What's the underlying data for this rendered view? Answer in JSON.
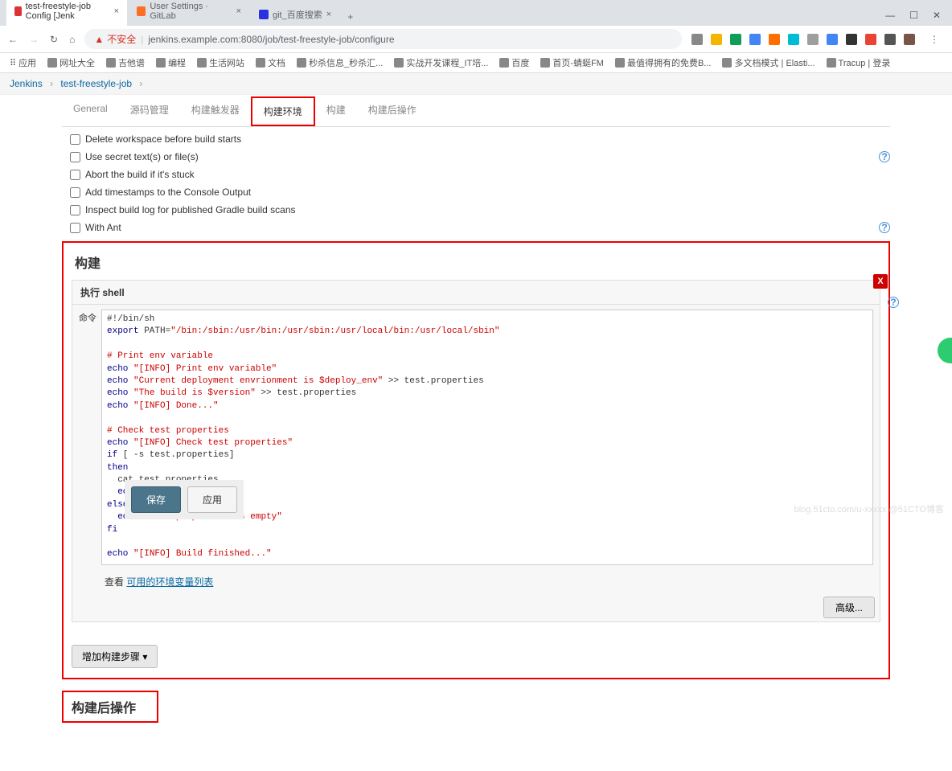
{
  "browser": {
    "tabs": [
      {
        "title": "test-freestyle-job Config [Jenk",
        "favicon": "#d33"
      },
      {
        "title": "User Settings · GitLab",
        "favicon": "#fc6d26"
      },
      {
        "title": "git_百度搜索",
        "favicon": "#2932e1"
      }
    ],
    "window_controls": {
      "min": "—",
      "max": "☐",
      "close": "✕"
    },
    "nav": {
      "back": "←",
      "forward": "→",
      "reload": "↻",
      "home": "⌂"
    },
    "insecure_label": "不安全",
    "url": "jenkins.example.com:8080/job/test-freestyle-job/configure",
    "ext_colors": [
      "#888",
      "#f4b400",
      "#0f9d58",
      "#4285f4",
      "#ff6f00",
      "#00bcd4",
      "#9e9e9e",
      "#4285f4",
      "#333",
      "#ea4335",
      "#555",
      "#795548"
    ],
    "menu": "⋮"
  },
  "bookmarks": {
    "apps": "应用",
    "items": [
      "网址大全",
      "吉他谱",
      "编程",
      "生活网站",
      "文档",
      "秒杀信息_秒杀汇...",
      "实战开发课程_IT培...",
      "百度",
      "首页-蜻蜓FM",
      "最值得拥有的免费B...",
      "多文档模式 | Elasti...",
      "Tracup | 登录"
    ]
  },
  "breadcrumb": {
    "root": "Jenkins",
    "job": "test-freestyle-job"
  },
  "config_tabs": [
    "General",
    "源码管理",
    "构建触发器",
    "构建环境",
    "构建",
    "构建后操作"
  ],
  "active_tab_index": 3,
  "env_checkboxes": [
    {
      "label": "Delete workspace before build starts",
      "help": false
    },
    {
      "label": "Use secret text(s) or file(s)",
      "help": true
    },
    {
      "label": "Abort the build if it's stuck",
      "help": false
    },
    {
      "label": "Add timestamps to the Console Output",
      "help": false
    },
    {
      "label": "Inspect build log for published Gradle build scans",
      "help": false
    },
    {
      "label": "With Ant",
      "help": true
    }
  ],
  "build": {
    "section_title": "构建",
    "step_title": "执行 shell",
    "command_label": "命令",
    "script_lines": [
      {
        "t": "#!/bin/sh",
        "cls": ""
      },
      {
        "t": "export PATH=\"/bin:/sbin:/usr/bin:/usr/sbin:/usr/local/bin:/usr/local/sbin\"",
        "cls": "mix1"
      },
      {
        "t": "",
        "cls": ""
      },
      {
        "t": "# Print env variable",
        "cls": "str"
      },
      {
        "t": "echo \"[INFO] Print env variable\"",
        "cls": "mix2"
      },
      {
        "t": "echo \"Current deployment envrionment is $deploy_env\" >> test.properties",
        "cls": "mix3"
      },
      {
        "t": "echo \"The build is $version\" >> test.properties",
        "cls": "mix3"
      },
      {
        "t": "echo \"[INFO] Done...\"",
        "cls": "mix2"
      },
      {
        "t": "",
        "cls": ""
      },
      {
        "t": "# Check test properties",
        "cls": "str"
      },
      {
        "t": "echo \"[INFO] Check test properties\"",
        "cls": "mix2"
      },
      {
        "t": "if [ -s test.properties]",
        "cls": "mix4"
      },
      {
        "t": "then",
        "cls": "kw"
      },
      {
        "t": "  cat test.properties",
        "cls": ""
      },
      {
        "t": "  echo \"[INFO] Done...\"",
        "cls": "mix2"
      },
      {
        "t": "else",
        "cls": "kw"
      },
      {
        "t": "  echo \"test.properties is empty\"",
        "cls": "mix2"
      },
      {
        "t": "fi",
        "cls": "kw"
      },
      {
        "t": "",
        "cls": ""
      },
      {
        "t": "echo \"[INFO] Build finished...\"",
        "cls": "mix2"
      }
    ],
    "env_link_prefix": "查看 ",
    "env_link": "可用的环境变量列表",
    "advanced_btn": "高级...",
    "add_step_btn": "增加构建步骤 ▾"
  },
  "post_build_title": "构建后操作",
  "buttons": {
    "save": "保存",
    "apply": "应用"
  },
  "watermark": "blog.51cto.com/u-xxxxx @51CTO博客"
}
